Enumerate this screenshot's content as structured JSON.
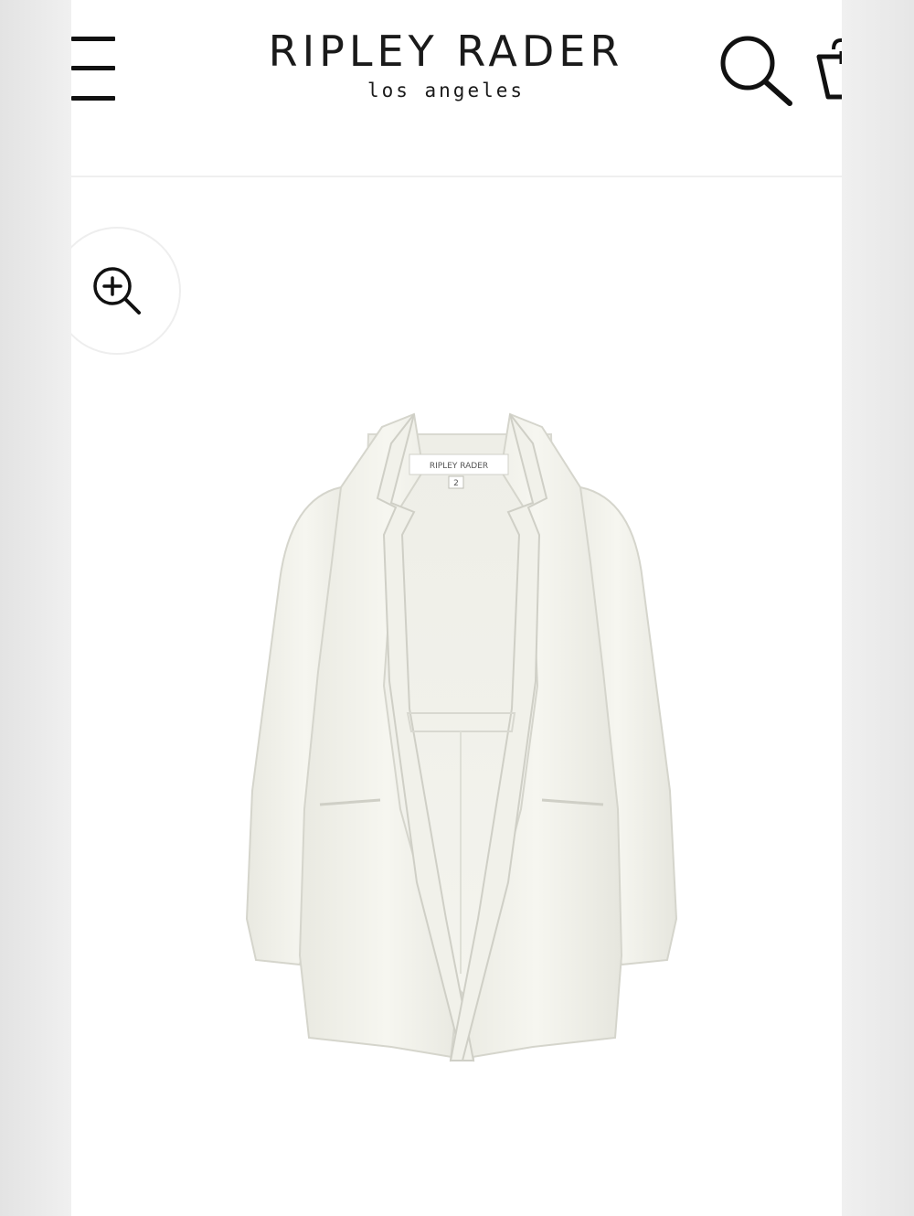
{
  "header": {
    "brand_name": "RIPLEY RADER",
    "brand_sub": "los angeles",
    "menu_icon": "hamburger-menu-icon",
    "search_icon": "search-icon",
    "cart_icon": "shopping-bag-icon"
  },
  "product": {
    "zoom_icon": "zoom-in-icon",
    "image_icon": "white-blazer-image",
    "label_brand": "RIPLEY RADER",
    "label_size": "2"
  },
  "colors": {
    "background": "#ffffff",
    "text": "#1a1a1a",
    "garment": "#f3f3ec"
  }
}
